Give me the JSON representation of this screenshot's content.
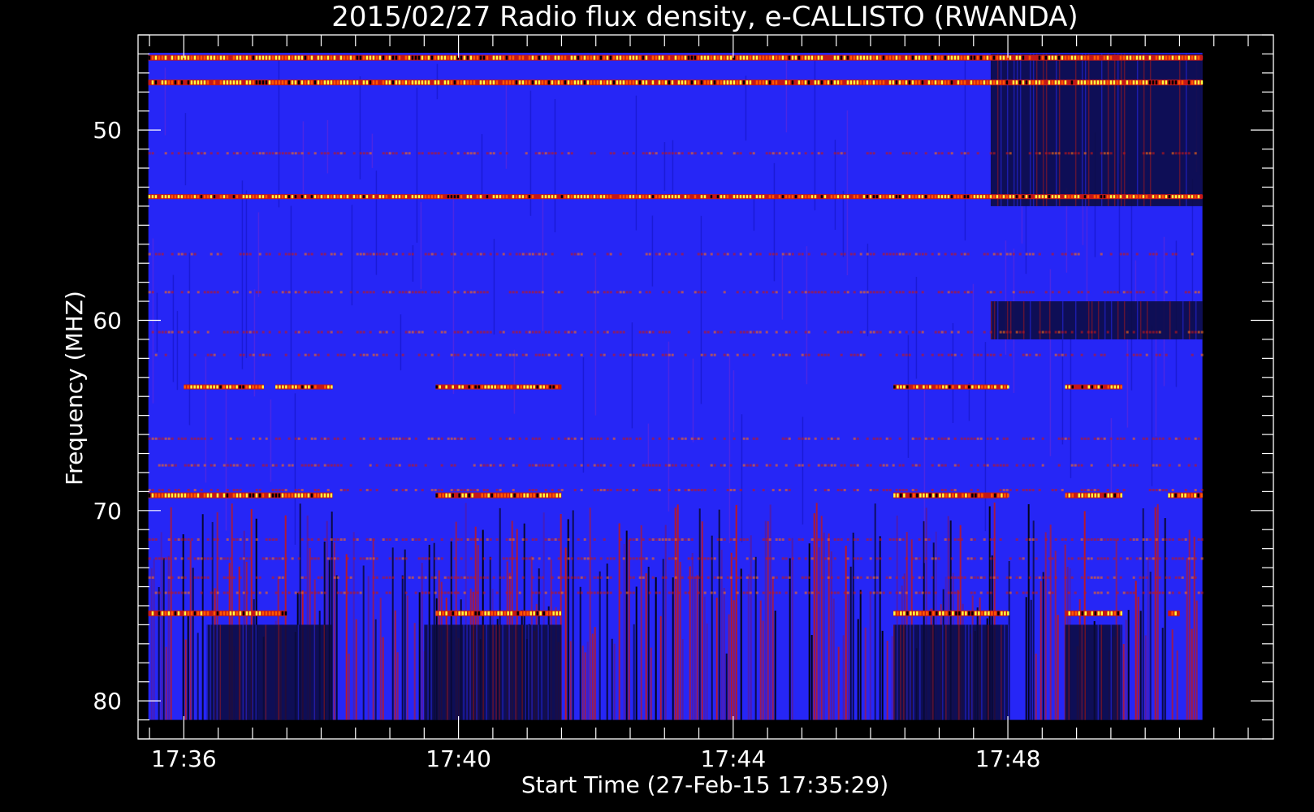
{
  "chart_data": {
    "type": "heatmap",
    "title": "2015/02/27  Radio flux density, e-CALLISTO (RWANDA)",
    "xlabel": "Start Time (27-Feb-15 17:35:29)",
    "ylabel": "Frequency (MHZ)",
    "x_unit": "time (HH:MM)",
    "xlim": [
      "17:35:20",
      "17:51:52"
    ],
    "data_time_range": [
      "17:35:29",
      "17:50:50"
    ],
    "ylim": [
      45,
      82
    ],
    "y_inverted": true,
    "x_ticks": [
      "17:36",
      "17:40",
      "17:44",
      "17:48"
    ],
    "y_ticks": [
      50,
      60,
      70,
      80
    ],
    "colormap": [
      "#000000",
      "#1a1aff",
      "#3a3aff",
      "#c41818",
      "#ff5a00",
      "#ffff40"
    ],
    "background_color": "#2626f6",
    "bright_bands_mhz": [
      {
        "freq": 46.2,
        "level": "high",
        "segments": [
          [
            "17:35:29",
            "17:50:50"
          ]
        ]
      },
      {
        "freq": 47.5,
        "level": "high",
        "segments": [
          [
            "17:35:29",
            "17:50:50"
          ]
        ]
      },
      {
        "freq": 53.5,
        "level": "medium",
        "segments": [
          [
            "17:35:29",
            "17:50:50"
          ]
        ]
      },
      {
        "freq": 63.5,
        "level": "medium",
        "segments": [
          [
            "17:36:00",
            "17:37:10"
          ],
          [
            "17:37:20",
            "17:38:10"
          ],
          [
            "17:39:40",
            "17:41:30"
          ],
          [
            "17:46:20",
            "17:48:00"
          ],
          [
            "17:48:50",
            "17:49:40"
          ]
        ]
      },
      {
        "freq": 69.2,
        "level": "high",
        "segments": [
          [
            "17:35:29",
            "17:38:10"
          ],
          [
            "17:39:40",
            "17:41:30"
          ],
          [
            "17:46:20",
            "17:48:00"
          ],
          [
            "17:48:50",
            "17:49:40"
          ],
          [
            "17:50:20",
            "17:50:50"
          ]
        ]
      },
      {
        "freq": 75.4,
        "level": "high",
        "segments": [
          [
            "17:35:29",
            "17:37:30"
          ],
          [
            "17:39:40",
            "17:41:30"
          ],
          [
            "17:46:20",
            "17:48:00"
          ],
          [
            "17:48:50",
            "17:49:40"
          ],
          [
            "17:50:20",
            "17:50:30"
          ]
        ]
      }
    ],
    "dark_regions": [
      {
        "time": [
          "17:47:45",
          "17:50:50"
        ],
        "freq": [
          46,
          54
        ]
      },
      {
        "time": [
          "17:47:45",
          "17:50:50"
        ],
        "freq": [
          59,
          61
        ]
      },
      {
        "time": [
          "17:36:20",
          "17:38:10"
        ],
        "freq": [
          76,
          81
        ]
      },
      {
        "time": [
          "17:39:30",
          "17:41:30"
        ],
        "freq": [
          76,
          81
        ]
      },
      {
        "time": [
          "17:46:20",
          "17:48:00"
        ],
        "freq": [
          76,
          81
        ]
      },
      {
        "time": [
          "17:48:50",
          "17:49:40"
        ],
        "freq": [
          76,
          81
        ]
      }
    ],
    "grid": false,
    "legend": "none"
  }
}
